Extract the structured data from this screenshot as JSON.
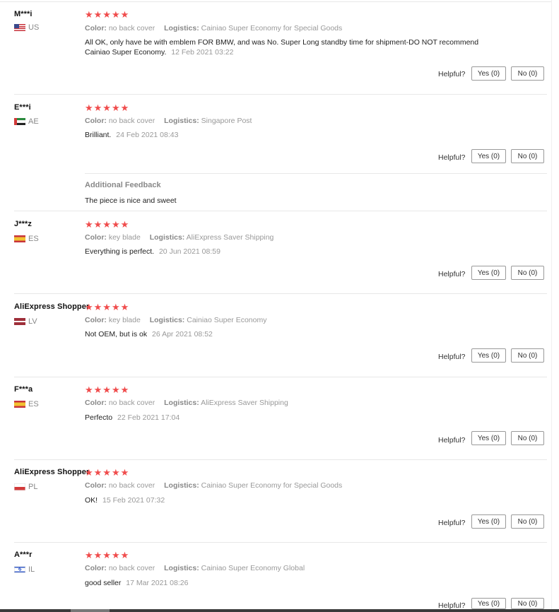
{
  "reviews": [
    {
      "user": "M***i",
      "country": "US",
      "flag": "us",
      "stars": "★★★★★",
      "color_label": "Color:",
      "color_value": "no back cover",
      "logistics_label": "Logistics:",
      "logistics_value": "Cainiao Super Economy for Special Goods",
      "text": "All OK, only have be with emblem FOR BMW, and was No. Super Long standby time for shipment-DO NOT recommend Cainiao Super Economy.",
      "date": "12 Feb 2021 03:22",
      "helpful": "Helpful?",
      "yes": "Yes (0)",
      "no": "No (0)"
    },
    {
      "user": "E***i",
      "country": "AE",
      "flag": "ae",
      "stars": "★★★★★",
      "color_label": "Color:",
      "color_value": "no back cover",
      "logistics_label": "Logistics:",
      "logistics_value": "Singapore Post",
      "text": "Brilliant.",
      "date": "24 Feb 2021 08:43",
      "helpful": "Helpful?",
      "yes": "Yes (0)",
      "no": "No (0)",
      "additional_title": "Additional Feedback",
      "additional_text": "The piece is nice and sweet"
    },
    {
      "user": "J***z",
      "country": "ES",
      "flag": "es",
      "stars": "★★★★★",
      "color_label": "Color:",
      "color_value": "key blade",
      "logistics_label": "Logistics:",
      "logistics_value": "AliExpress Saver Shipping",
      "text": "Everything is perfect.",
      "date": "20 Jun 2021 08:59",
      "helpful": "Helpful?",
      "yes": "Yes (0)",
      "no": "No (0)"
    },
    {
      "user": "AliExpress Shopper",
      "country": "LV",
      "flag": "lv",
      "stars": "★★★★★",
      "color_label": "Color:",
      "color_value": "key blade",
      "logistics_label": "Logistics:",
      "logistics_value": "Cainiao Super Economy",
      "text": "Not OEM, but is ok",
      "date": "26 Apr 2021 08:52",
      "helpful": "Helpful?",
      "yes": "Yes (0)",
      "no": "No (0)"
    },
    {
      "user": "F***a",
      "country": "ES",
      "flag": "es",
      "stars": "★★★★★",
      "color_label": "Color:",
      "color_value": "no back cover",
      "logistics_label": "Logistics:",
      "logistics_value": "AliExpress Saver Shipping",
      "text": "Perfecto",
      "date": "22 Feb 2021 17:04",
      "helpful": "Helpful?",
      "yes": "Yes (0)",
      "no": "No (0)"
    },
    {
      "user": "AliExpress Shopper",
      "country": "PL",
      "flag": "pl",
      "stars": "★★★★★",
      "color_label": "Color:",
      "color_value": "no back cover",
      "logistics_label": "Logistics:",
      "logistics_value": "Cainiao Super Economy for Special Goods",
      "text": "OK!",
      "date": "15 Feb 2021 07:32",
      "helpful": "Helpful?",
      "yes": "Yes (0)",
      "no": "No (0)"
    },
    {
      "user": "A***r",
      "country": "IL",
      "flag": "il",
      "stars": "★★★★★",
      "color_label": "Color:",
      "color_value": "no back cover",
      "logistics_label": "Logistics:",
      "logistics_value": "Cainiao Super Economy Global",
      "text": "good seller",
      "date": "17 Mar 2021 08:26",
      "helpful": "Helpful?",
      "yes": "Yes (0)",
      "no": "No (0)"
    }
  ],
  "colors": {
    "star": "#f04c4c",
    "label": "#888888",
    "muted": "#999999"
  }
}
